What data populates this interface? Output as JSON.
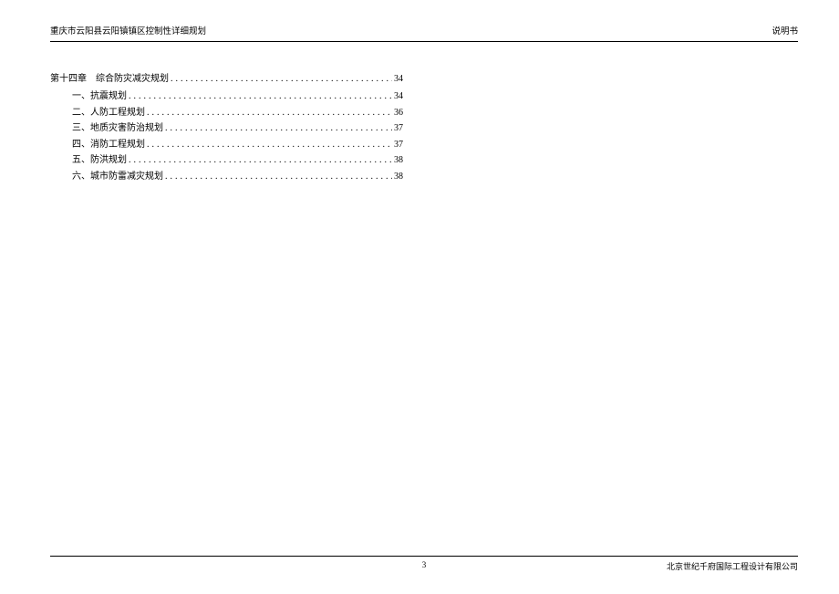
{
  "header": {
    "left": "重庆市云阳县云阳镇镇区控制性详细规划",
    "right": "说明书"
  },
  "toc": {
    "chapter": {
      "label": "第十四章　综合防灾减灾规划",
      "page": "34"
    },
    "sections": [
      {
        "label": "一、抗震规划",
        "page": "34"
      },
      {
        "label": "二、人防工程规划",
        "page": "36"
      },
      {
        "label": "三、地质灾害防治规划",
        "page": "37"
      },
      {
        "label": "四、消防工程规划",
        "page": "37"
      },
      {
        "label": "五、防洪规划",
        "page": "38"
      },
      {
        "label": "六、城市防雷减灾规划",
        "page": "38"
      }
    ]
  },
  "footer": {
    "page_number": "3",
    "company": "北京世纪千府国际工程设计有限公司"
  },
  "dots": "..............................................................................."
}
